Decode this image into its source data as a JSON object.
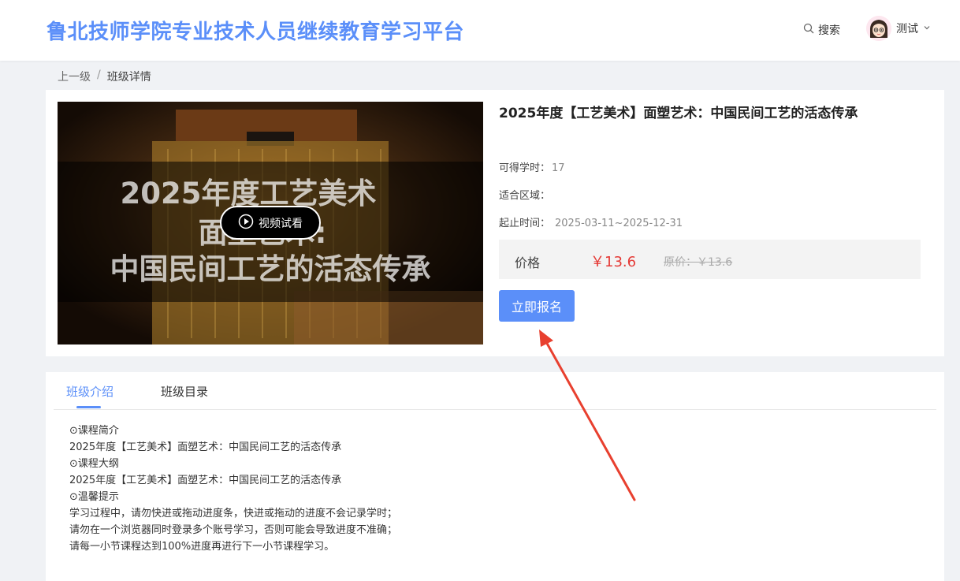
{
  "header": {
    "site_title": "鲁北技师学院专业技术人员继续教育学习平台",
    "search_label": "搜索",
    "user_name": "测试"
  },
  "breadcrumb": {
    "parent": "上一级",
    "separator": "/",
    "current": "班级详情"
  },
  "video": {
    "text_line1": "2025年度工艺美术",
    "text_line2": "面塑艺术:",
    "text_line3": "中国民间工艺的活态传承",
    "play_label": "视频试看"
  },
  "course": {
    "title": "2025年度【工艺美术】面塑艺术：中国民间工艺的活态传承",
    "hours_label": "可得学时：",
    "hours_value": "17",
    "region_label": "适合区域：",
    "region_value": "",
    "period_label": "起止时间：",
    "period_value": "2025-03-11~2025-12-31",
    "price_label": "价格",
    "price_now": "￥13.6",
    "price_old": "原价：￥13.6",
    "enroll_label": "立即报名"
  },
  "tabs": [
    {
      "label": "班级介绍",
      "active": true
    },
    {
      "label": "班级目录",
      "active": false
    }
  ],
  "description": [
    "⊙课程简介",
    "2025年度【工艺美术】面塑艺术：中国民间工艺的活态传承",
    "⊙课程大纲",
    "2025年度【工艺美术】面塑艺术：中国民间工艺的活态传承",
    "⊙温馨提示",
    "学习过程中，请勿快进或拖动进度条，快进或拖动的进度不会记录学时；",
    "请勿在一个浏览器同时登录多个账号学习，否则可能会导致进度不准确；",
    "请每一小节课程达到100%进度再进行下一小节课程学习。"
  ],
  "colors": {
    "accent": "#5b8ff9",
    "price": "#e53935",
    "annotation": "#e8402f"
  }
}
